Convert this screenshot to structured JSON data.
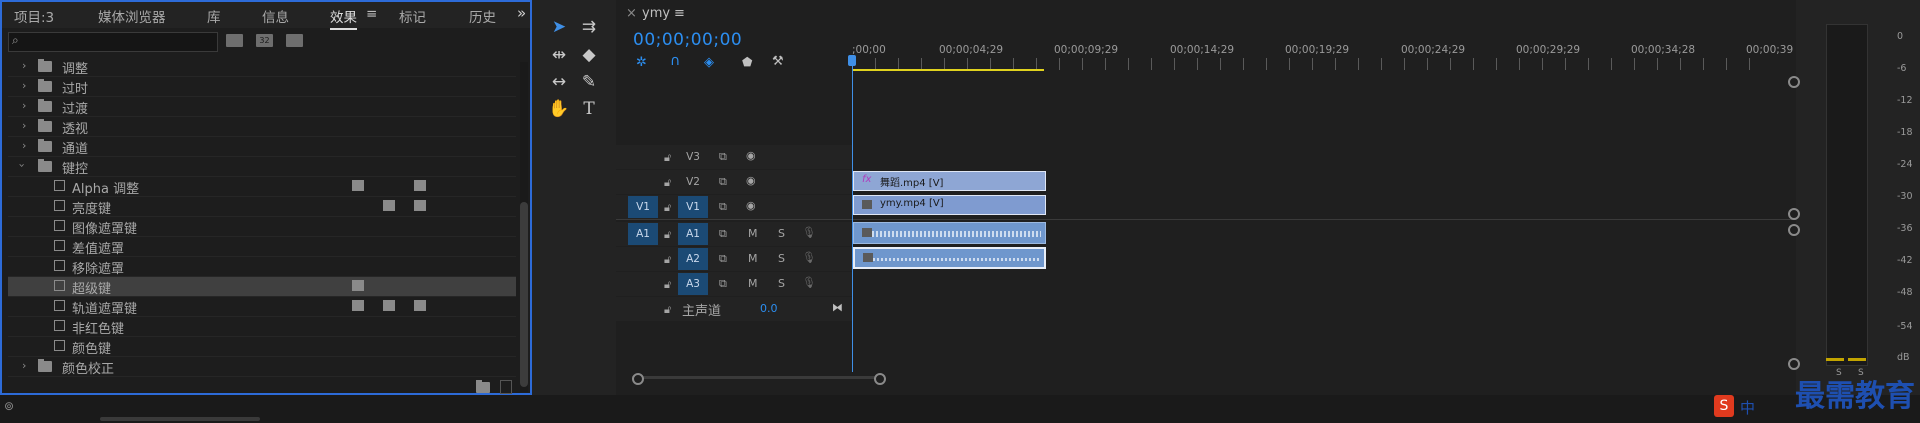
{
  "effects_panel": {
    "tabs": [
      {
        "label": "项目:3",
        "active": false
      },
      {
        "label": "媒体浏览器",
        "active": false
      },
      {
        "label": "库",
        "active": false
      },
      {
        "label": "信息",
        "active": false
      },
      {
        "label": "效果",
        "active": true
      },
      {
        "label": "标记",
        "active": false
      },
      {
        "label": "历史",
        "active": false
      }
    ],
    "menu_glyph": "≡",
    "overflow_glyph": "»",
    "search": {
      "value": "",
      "placeholder": ""
    },
    "filter_buttons": [
      "32"
    ],
    "folders": [
      {
        "label": "调整",
        "expanded": false
      },
      {
        "label": "过时",
        "expanded": false
      },
      {
        "label": "过渡",
        "expanded": false
      },
      {
        "label": "透视",
        "expanded": false
      },
      {
        "label": "通道",
        "expanded": false
      },
      {
        "label": "键控",
        "expanded": true
      }
    ],
    "keying_items": [
      {
        "label": "Alpha 调整",
        "selected": false
      },
      {
        "label": "亮度键",
        "selected": false
      },
      {
        "label": "图像遮罩键",
        "selected": false
      },
      {
        "label": "差值遮罩",
        "selected": false
      },
      {
        "label": "移除遮罩",
        "selected": false
      },
      {
        "label": "超级键",
        "selected": true
      },
      {
        "label": "轨道遮罩键",
        "selected": false
      },
      {
        "label": "非红色键",
        "selected": false
      },
      {
        "label": "颜色键",
        "selected": false
      }
    ],
    "last_folder": {
      "label": "颜色校正",
      "expanded": false
    }
  },
  "timeline": {
    "tab_label": "ymy",
    "timecode": "00;00;00;00",
    "ruler": [
      ";00;00",
      "00;00;04;29",
      "00;00;09;29",
      "00;00;14;29",
      "00;00;19;29",
      "00;00;24;29",
      "00;00;29;29",
      "00;00;34;28",
      "00;00;39"
    ],
    "video_tracks": [
      {
        "name": "V3",
        "source": ""
      },
      {
        "name": "V2",
        "source": ""
      },
      {
        "name": "V1",
        "source": "V1"
      }
    ],
    "audio_tracks": [
      {
        "name": "A1",
        "source": "A1",
        "m": "M",
        "s": "S"
      },
      {
        "name": "A2",
        "source": "",
        "m": "M",
        "s": "S"
      },
      {
        "name": "A3",
        "source": "",
        "m": "M",
        "s": "S"
      }
    ],
    "master": {
      "label": "主声道",
      "value": "0.0"
    },
    "clips": [
      {
        "track": "V2",
        "label": "舞蹈.mp4 [V]",
        "fx": "fx"
      },
      {
        "track": "V1",
        "label": "ymy.mp4 [V]"
      }
    ]
  },
  "meters": {
    "db_labels": [
      "0",
      "-6",
      "-12",
      "-18",
      "-24",
      "-30",
      "-36",
      "-42",
      "-48",
      "-54",
      "dB"
    ],
    "solo": [
      "S",
      "S"
    ]
  },
  "watermark": {
    "text": "最需教育",
    "ime": "中"
  },
  "colors": {
    "accent": "#2c8ef0",
    "track_button": "#1b4a75",
    "video_clip": "#8ea6d4",
    "audio_clip": "#6f97cd",
    "work_area": "#e0d21e"
  }
}
